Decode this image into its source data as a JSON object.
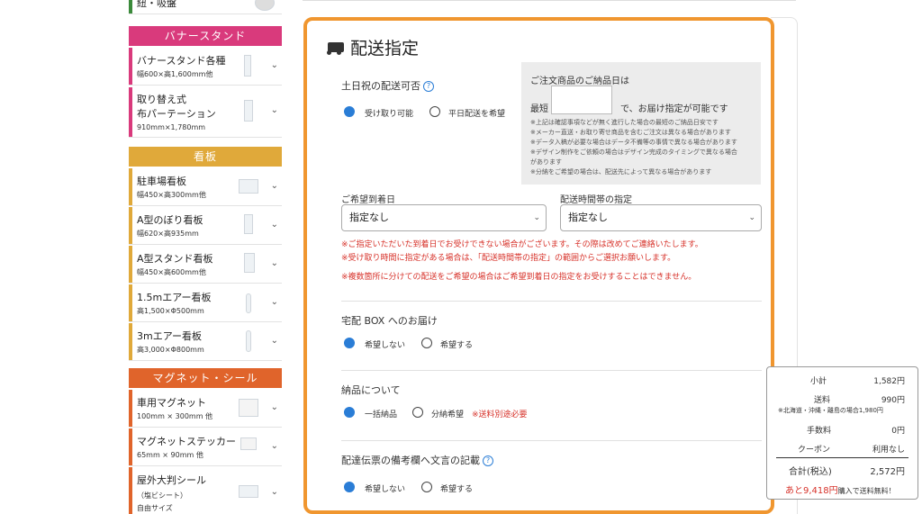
{
  "sidebar": {
    "top_item": "紐・吸盤",
    "sections": [
      {
        "heading": "バナースタンド",
        "color": "#d93a7c"
      },
      {
        "heading": "看板",
        "color": "#e0a93a"
      },
      {
        "heading": "マグネット・シール",
        "color": "#e0642b"
      }
    ],
    "items": [
      {
        "title": "バナースタンド各種",
        "sub": "幅600×高1,600mm他",
        "color": "#d93a7c"
      },
      {
        "title": "取り替え式",
        "title2": "布パーテーション",
        "sub": "910mm×1,780mm",
        "color": "#d93a7c"
      },
      {
        "title": "駐車場看板",
        "sub": "幅450×高300mm他",
        "color": "#e0a93a"
      },
      {
        "title": "A型のぼり看板",
        "sub": "幅620×高935mm",
        "color": "#e0a93a"
      },
      {
        "title": "A型スタンド看板",
        "sub": "幅450×高600mm他",
        "color": "#e0a93a"
      },
      {
        "title": "1.5mエアー看板",
        "sub": "高1,500×Φ500mm",
        "color": "#e0a93a"
      },
      {
        "title": "3mエアー看板",
        "sub": "高3,000×Φ800mm",
        "color": "#e0a93a"
      },
      {
        "title": "車用マグネット",
        "sub": "100mm × 300mm 他",
        "color": "#e0642b"
      },
      {
        "title": "マグネットステッカー",
        "sub": "65mm × 90mm 他",
        "color": "#e0642b"
      },
      {
        "title": "屋外大判シール",
        "sub": "（塩ビシート）",
        "sub2": "自由サイズ",
        "color": "#e0642b"
      }
    ]
  },
  "main": {
    "title": "配送指定",
    "weekend": {
      "label": "土日祝の配送可否",
      "opt1": "受け取り可能",
      "opt2": "平日配送を希望"
    },
    "delivery_info": {
      "title": "ご注文商品のご納品日は",
      "min_label": "最短",
      "suffix": "で、お届け指定が可能です",
      "notes": [
        "※上記は確認事項などが無く進行した場合の最短のご納品日安です",
        "※メーカー直送・お取り寄せ商品を含むご注文は異なる場合があります",
        "※データ入稿が必要な場合はデータ不備等の事情で異なる場合があります",
        "※デザイン制作をご依頼の場合はデザイン完成のタイミングで異なる場合",
        "があります",
        "※分納をご希望の場合は、配送先によって異なる場合があります"
      ]
    },
    "date": {
      "label": "ご希望到着日",
      "value": "指定なし"
    },
    "time": {
      "label": "配送時間帯の指定",
      "value": "指定なし"
    },
    "warnings": [
      "※ご指定いただいた到着日でお受けできない場合がございます。その際は改めてご連絡いたします。",
      "※受け取り時間に指定がある場合は、「配送時間帯の指定」の範囲からご選択お願いします。",
      "※複数箇所に分けての配送をご希望の場合はご希望到着日の指定をお受けすることはできません。"
    ],
    "box": {
      "label": "宅配 BOX へのお届け",
      "opt1": "希望しない",
      "opt2": "希望する"
    },
    "shipping": {
      "label": "納品について",
      "opt1": "一括納品",
      "opt2": "分納希望",
      "note": "※送料別途必要"
    },
    "memo": {
      "label": "配達伝票の備考欄へ文言の記載",
      "opt1": "希望しない",
      "opt2": "希望する"
    }
  },
  "summary": {
    "subtotal_label": "小計",
    "subtotal": "1,582円",
    "shipping_label": "送料",
    "shipping": "990円",
    "remote_note": "※北海道・沖縄・離島の場合1,980円",
    "fee_label": "手数料",
    "fee": "0円",
    "coupon_label": "クーポン",
    "coupon": "利用なし",
    "total_label": "合計(税込)",
    "total": "2,572円",
    "free_prefix": "あと9,418円",
    "free_suffix": "購入で送料無料！"
  },
  "colors": {
    "accent": "#f0962f",
    "radio": "#2a7dd6",
    "warning": "#d7322a"
  }
}
